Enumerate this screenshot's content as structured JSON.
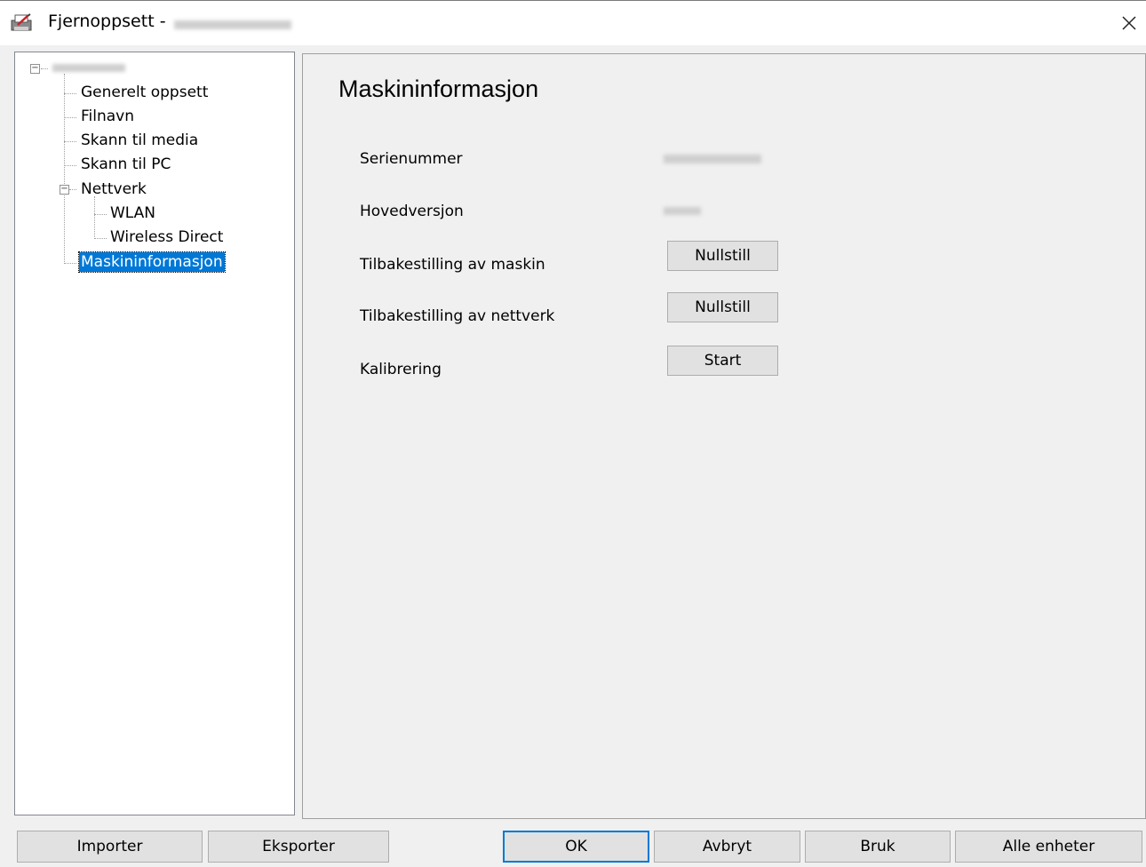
{
  "window": {
    "title": "Fjernoppsett -",
    "close_glyph": "×"
  },
  "tree": {
    "root_toggle": "−",
    "network_toggle": "−",
    "items": [
      {
        "label": "Generelt oppsett"
      },
      {
        "label": "Filnavn"
      },
      {
        "label": "Skann til media"
      },
      {
        "label": "Skann til PC"
      },
      {
        "label": "Nettverk"
      },
      {
        "label": "WLAN"
      },
      {
        "label": "Wireless Direct"
      },
      {
        "label": "Maskininformasjon",
        "selected": true
      }
    ]
  },
  "panel": {
    "title": "Maskininformasjon",
    "rows": {
      "serial_label": "Serienummer",
      "main_version_label": "Hovedversjon",
      "machine_reset_label": "Tilbakestilling av maskin",
      "machine_reset_button": "Nullstill",
      "network_reset_label": "Tilbakestilling av nettverk",
      "network_reset_button": "Nullstill",
      "calibration_label": "Kalibrering",
      "calibration_button": "Start"
    }
  },
  "footer": {
    "import": "Importer",
    "export": "Eksporter",
    "ok": "OK",
    "cancel": "Avbryt",
    "apply": "Bruk",
    "all_devices": "Alle enheter"
  },
  "colors": {
    "accent": "#0078d7",
    "selection": "#0078d7",
    "window_bg": "#f0f0f0"
  },
  "icons": {
    "app": "printer-settings-icon",
    "close": "close-icon",
    "tree_toggle": "tree-collapse-icon"
  }
}
